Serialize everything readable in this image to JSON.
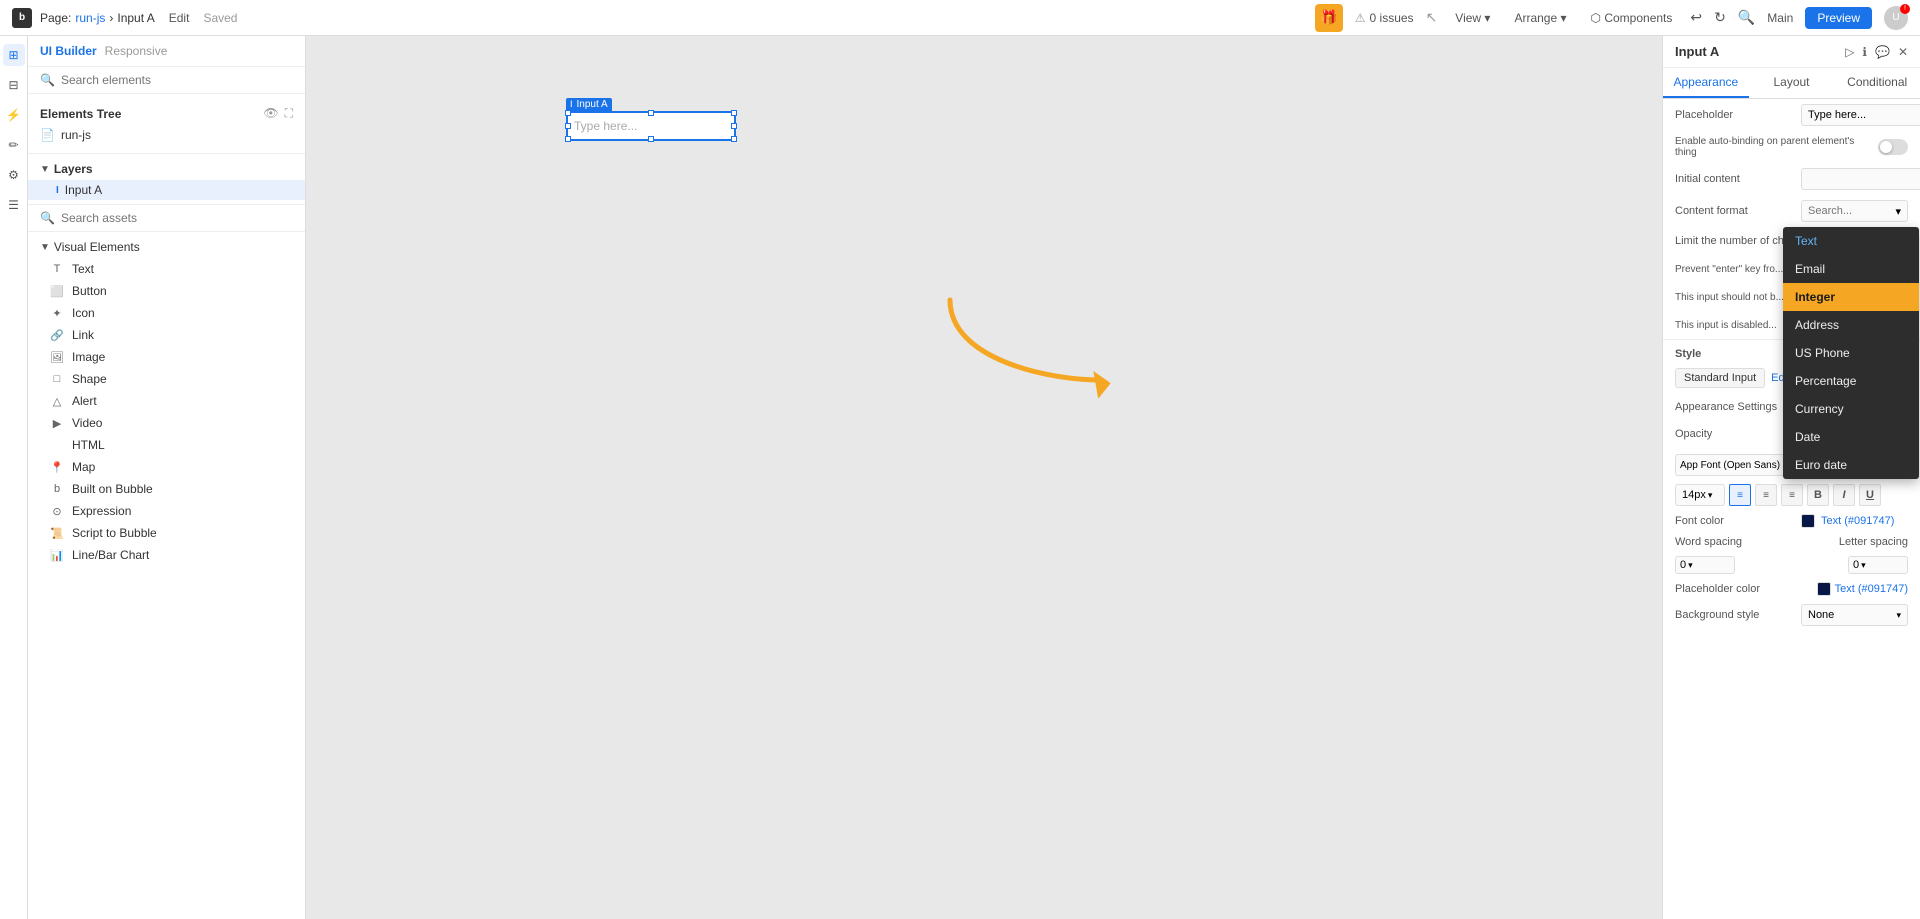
{
  "topbar": {
    "logo": "b",
    "page_label": "Page:",
    "page_name": "run-js",
    "separator": "›",
    "input_name": "Input A",
    "edit_label": "Edit",
    "saved_label": "Saved",
    "issues_count": "0 issues",
    "view_label": "View",
    "arrange_label": "Arrange",
    "components_label": "Components",
    "main_label": "Main",
    "preview_label": "Preview"
  },
  "left_panel": {
    "ui_builder_label": "UI Builder",
    "responsive_label": "Responsive",
    "search_elements_placeholder": "Search elements",
    "elements_tree_label": "Elements Tree",
    "tree_items": [
      {
        "name": "run-js",
        "icon": "📄"
      }
    ],
    "layers_label": "Layers",
    "layers_items": [
      {
        "name": "Input A",
        "icon": "I",
        "selected": true
      }
    ],
    "search_assets_placeholder": "Search assets",
    "visual_elements_label": "Visual Elements",
    "visual_items": [
      {
        "icon": "T",
        "name": "Text"
      },
      {
        "icon": "⬜",
        "name": "Button"
      },
      {
        "icon": "✦",
        "name": "Icon"
      },
      {
        "icon": "🔗",
        "name": "Link"
      },
      {
        "icon": "🖼",
        "name": "Image"
      },
      {
        "icon": "□",
        "name": "Shape"
      },
      {
        "icon": "△",
        "name": "Alert"
      },
      {
        "icon": "▶",
        "name": "Video"
      },
      {
        "icon": "</>",
        "name": "HTML"
      },
      {
        "icon": "📍",
        "name": "Map"
      },
      {
        "icon": "b",
        "name": "Built on Bubble"
      },
      {
        "icon": "⊙",
        "name": "Expression"
      },
      {
        "icon": "📜",
        "name": "Script to Bubble"
      },
      {
        "icon": "📊",
        "name": "Line/Bar Chart"
      }
    ]
  },
  "canvas": {
    "input_label": "Input A",
    "input_placeholder": "Type here..."
  },
  "right_panel": {
    "title": "Input A",
    "tabs": [
      "Appearance",
      "Layout",
      "Conditional"
    ],
    "active_tab": "Appearance",
    "placeholder_label": "Placeholder",
    "placeholder_value": "Type here...",
    "auto_binding_label": "Enable auto-binding on parent element's thing",
    "initial_content_label": "Initial content",
    "content_format_label": "Content format",
    "content_format_search": "Search...",
    "limit_chars_label": "Limit the number of cha...",
    "prevent_enter_label": "Prevent \"enter\" key fro...",
    "input_should_not_label": "This input should not b...",
    "input_disabled_label": "This input is disabled...",
    "style_label": "Style",
    "standard_input_label": "Standard Input",
    "edit_style_label": "Edit style",
    "appearance_settings_label": "Appearance Settings",
    "opacity_label": "Opacity",
    "app_font_label": "App Font (Open Sans)",
    "font_weight": "400",
    "font_size": "14px",
    "font_color_label": "Font color",
    "font_color_text": "Text (#091747)",
    "font_color_hex": "#091747",
    "word_spacing_label": "Word spacing",
    "word_spacing_value": "0",
    "letter_spacing_label": "Letter spacing",
    "letter_spacing_value": "0",
    "placeholder_color_label": "Placeholder color",
    "placeholder_color_text": "Text (#091747)",
    "placeholder_color_hex": "#091747",
    "background_style_label": "Background style",
    "background_style_value": "None",
    "dropdown_items": [
      {
        "label": "Text",
        "type": "blue"
      },
      {
        "label": "Email",
        "type": "normal"
      },
      {
        "label": "Integer",
        "type": "highlighted"
      },
      {
        "label": "Address",
        "type": "normal"
      },
      {
        "label": "US Phone",
        "type": "normal"
      },
      {
        "label": "Percentage",
        "type": "normal"
      },
      {
        "label": "Currency",
        "type": "normal"
      },
      {
        "label": "Date",
        "type": "normal"
      },
      {
        "label": "Euro date",
        "type": "normal"
      }
    ]
  }
}
